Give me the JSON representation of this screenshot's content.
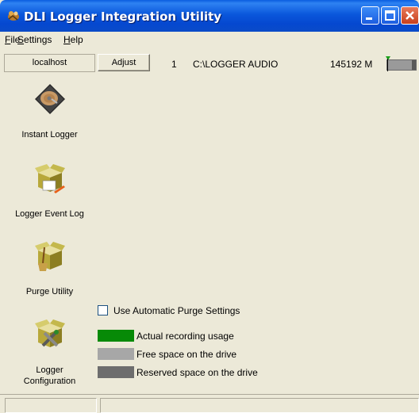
{
  "window": {
    "title": "DLI Logger Integration Utility",
    "title_color": "#ffffff",
    "titlebar_color": "#0a57dc"
  },
  "menu": {
    "file": {
      "accel": "F",
      "rest": "ile"
    },
    "settings": {
      "accel": "S",
      "rest": "ettings"
    },
    "help": {
      "accel": "H",
      "rest": "elp"
    }
  },
  "sidebar": {
    "host": "localhost",
    "items": [
      {
        "label": "Instant Logger",
        "icon": "hard-disk-icon"
      },
      {
        "label": "Logger Event Log",
        "icon": "event-log-box-icon"
      },
      {
        "label": "Purge Utility",
        "icon": "purge-broom-box-icon"
      },
      {
        "label_line1": "Logger",
        "label_line2": "Configuration",
        "icon": "configuration-tools-box-icon"
      }
    ]
  },
  "drive": {
    "adjust_label": "Adjust",
    "number": "1",
    "path": "C:\\LOGGER AUDIO",
    "size": "145192 M",
    "free_fraction": 0.87
  },
  "purge": {
    "label": "Use Automatic Purge Settings",
    "checked": false
  },
  "legend": [
    {
      "label": "Actual recording usage",
      "color": "#078a07"
    },
    {
      "label": "Free space on the drive",
      "color": "#a7a7a7"
    },
    {
      "label": "Reserved space on the drive",
      "color": "#6d6d6d"
    }
  ]
}
